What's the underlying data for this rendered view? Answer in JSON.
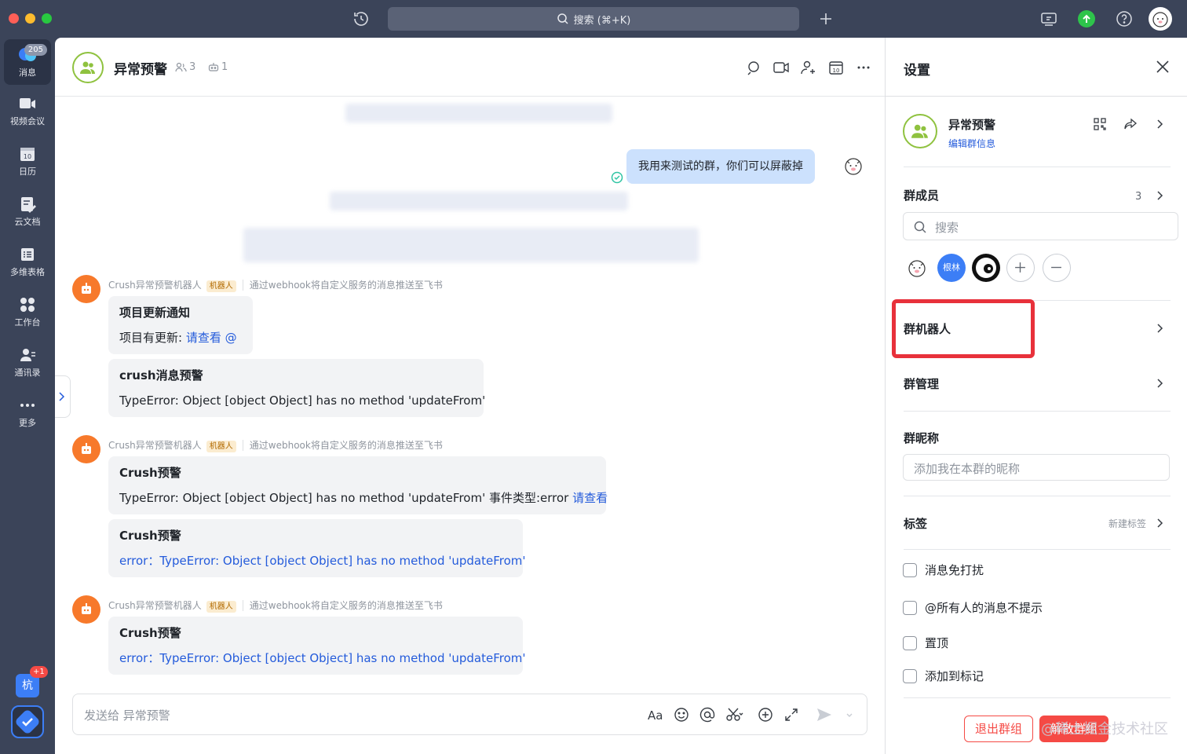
{
  "topbar": {
    "search_label": "搜索 (⌘+K)"
  },
  "nav": {
    "unread_badge": "205",
    "items": [
      {
        "label": "消息"
      },
      {
        "label": "视频会议"
      },
      {
        "label": "日历"
      },
      {
        "label": "云文档"
      },
      {
        "label": "多维表格"
      },
      {
        "label": "工作台"
      },
      {
        "label": "通讯录"
      },
      {
        "label": "更多"
      }
    ],
    "calendar_day": "10",
    "hang_label": "杭",
    "hang_badge": "+1"
  },
  "chat": {
    "title": "异常预警",
    "member_count": "3",
    "bot_count": "1",
    "calendar_day": "10",
    "my_message": "我用来测试的群，你们可以屏蔽掉",
    "messages": [
      {
        "sender": "Crush异常预警机器人",
        "tag": "机器人",
        "desc": "通过webhook将自定义服务的消息推送至飞书",
        "cards": [
          {
            "title": "项目更新通知",
            "text": "项目有更新: ",
            "link": "请查看 @"
          },
          {
            "title": "crush消息预警",
            "text": "TypeError: Object [object Object] has no method 'updateFrom'"
          }
        ]
      },
      {
        "sender": "Crush异常预警机器人",
        "tag": "机器人",
        "desc": "通过webhook将自定义服务的消息推送至飞书",
        "cards": [
          {
            "title": "Crush预警",
            "text": "TypeError: Object [object Object] has no method 'updateFrom' 事件类型:error ",
            "link": "请查看"
          },
          {
            "title": "Crush预警",
            "link": "error：TypeError: Object [object Object] has no method 'updateFrom'"
          }
        ]
      },
      {
        "sender": "Crush异常预警机器人",
        "tag": "机器人",
        "desc": "通过webhook将自定义服务的消息推送至飞书",
        "cards": [
          {
            "title": "Crush预警",
            "link": "error：TypeError: Object [object Object] has no method 'updateFrom'"
          }
        ]
      }
    ],
    "composer_placeholder": "发送给 异常预警"
  },
  "settings": {
    "title": "设置",
    "group_name": "异常预警",
    "edit_info": "编辑群信息",
    "members_label": "群成员",
    "members_count": "3",
    "search_placeholder": "搜索",
    "member_blue_label": "根林",
    "bots_label": "群机器人",
    "manage_label": "群管理",
    "nickname_label": "群昵称",
    "nickname_placeholder": "添加我在本群的昵称",
    "tags_label": "标签",
    "new_tag": "新建标签",
    "options": [
      "消息免打扰",
      "@所有人的消息不提示",
      "置顶",
      "添加到标记"
    ],
    "exit_label": "退出群组",
    "disband_label": "解散群组",
    "watermark": "@稀土掘金技术社区"
  },
  "colors": {
    "accent": "#245bdb",
    "danger": "#f54a45",
    "sidebar": "#3b4459",
    "bubble_mine": "#cce1fd",
    "bot_avatar": "#f7792b",
    "highlight": "#e8313b"
  }
}
